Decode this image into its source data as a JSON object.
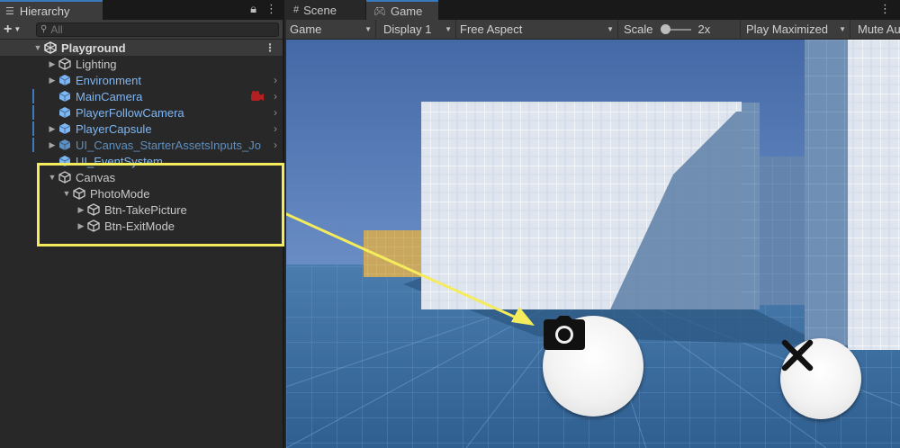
{
  "hierarchy": {
    "tab_title": "Hierarchy",
    "search_placeholder": "All",
    "scene": "Playground",
    "items": [
      {
        "label": "Lighting"
      },
      {
        "label": "Environment"
      },
      {
        "label": "MainCamera"
      },
      {
        "label": "PlayerFollowCamera"
      },
      {
        "label": "PlayerCapsule"
      },
      {
        "label": "UI_Canvas_StarterAssetsInputs_Jo"
      },
      {
        "label": "UI_EventSystem"
      },
      {
        "label": "Canvas"
      },
      {
        "label": "PhotoMode"
      },
      {
        "label": "Btn-TakePicture"
      },
      {
        "label": "Btn-ExitMode"
      }
    ]
  },
  "game": {
    "tabs": [
      {
        "label": "Scene"
      },
      {
        "label": "Game"
      }
    ],
    "toolbar": {
      "display_type": "Game",
      "display": "Display 1",
      "aspect": "Free Aspect",
      "scale_label": "Scale",
      "scale_value": "2x",
      "play_mode": "Play Maximized",
      "mute": "Mute Au"
    }
  },
  "colors": {
    "highlight": "#f4ec5c",
    "prefab_text": "#7fb6f2",
    "accent": "#3a79bb",
    "sky": "#4a73b0",
    "floor": "#3d6e9e"
  },
  "icons": {
    "take_picture": "camera-icon",
    "exit_mode": "close-icon"
  }
}
